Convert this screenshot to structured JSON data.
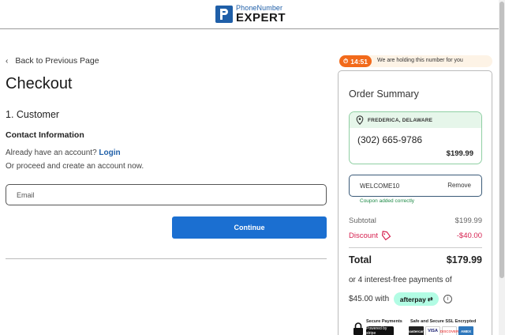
{
  "header": {
    "logo_top": "PhoneNumber",
    "logo_bottom": "EXPERT",
    "logo_mark_letter": "P"
  },
  "checkout": {
    "back_label": "Back to Previous Page",
    "page_title": "Checkout",
    "step_title": "1. Customer",
    "contact_heading": "Contact Information",
    "have_account_text": "Already have an account?",
    "login_link": "Login",
    "proceed_text": "Or proceed and create an account now.",
    "email_placeholder": "Email",
    "continue_label": "Continue"
  },
  "timer": {
    "time": "14:51",
    "message": "We are holding this number for you"
  },
  "order_summary": {
    "title": "Order Summary",
    "location": "FREDERICA, DELAWARE",
    "phone_number": "(302) 665-9786",
    "price": "$199.99",
    "coupon_code": "WELCOME10",
    "coupon_remove": "Remove",
    "coupon_note": "Coupon added correctly",
    "subtotal_label": "Subtotal",
    "subtotal_value": "$199.99",
    "discount_label": "Discount",
    "discount_value": "-$40.00",
    "total_label": "Total",
    "total_value": "$179.99",
    "installment_line1": "or 4 interest-free payments of",
    "installment_amount": "$45.00 with",
    "afterpay_label": "afterpay"
  },
  "security": {
    "secure_payments": "Secure Payments",
    "powered_by": "Powered by stripe",
    "ssl": "Safe and Secure SSL Encrypted",
    "cards": [
      "mastercard",
      "VISA",
      "DISCOVER",
      "AMEX"
    ]
  },
  "colors": {
    "brand_blue": "#1f5fa8",
    "continue_blue": "#1b6fd1",
    "timer_orange": "#f26a1b",
    "discount_red": "#d6204f",
    "success_green": "#1e8a47",
    "afterpay_mint": "#b2fce4"
  }
}
